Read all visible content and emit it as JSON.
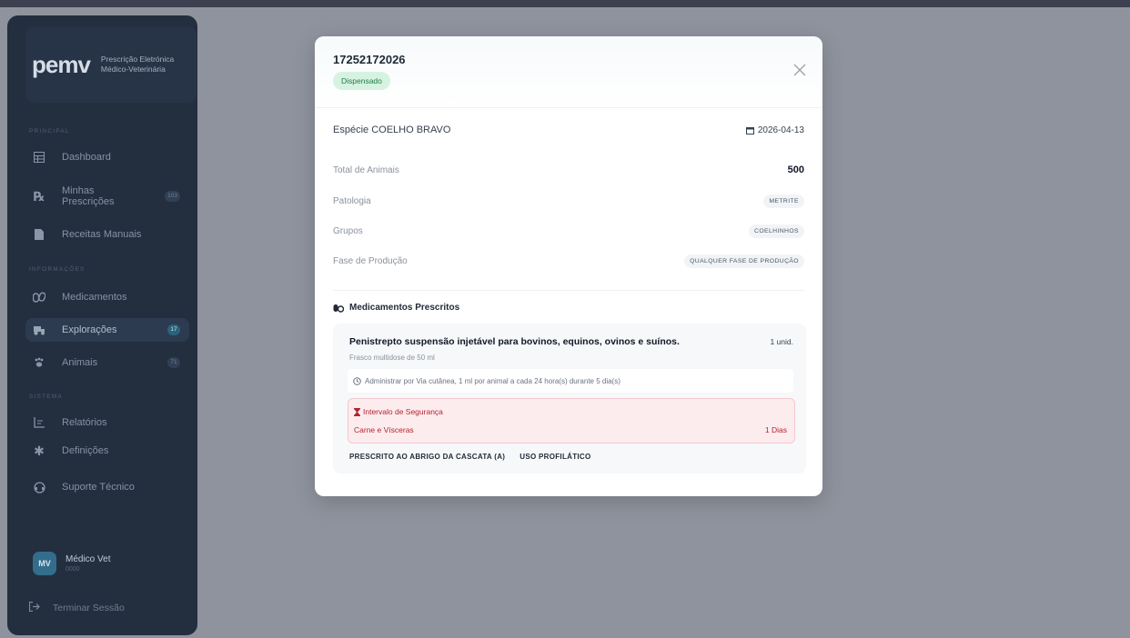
{
  "brand": {
    "logo": "pemv",
    "line1": "Prescrição Eletrónica",
    "line2": "Médico-Veterinária"
  },
  "sidebar": {
    "sections": [
      "Principal",
      "Informações",
      "Sistema"
    ],
    "items": [
      {
        "label": "Dashboard",
        "icon": "grid-icon"
      },
      {
        "label": "Minhas Prescrições",
        "icon": "rx-icon",
        "badge": "103"
      },
      {
        "label": "Receitas Manuais",
        "icon": "document-icon"
      },
      {
        "label": "Medicamentos",
        "icon": "pills-icon"
      },
      {
        "label": "Explorações",
        "icon": "tractor-icon",
        "badge": "17"
      },
      {
        "label": "Animais",
        "icon": "paw-icon",
        "badge": "71"
      },
      {
        "label": "Relatórios",
        "icon": "chart-icon"
      },
      {
        "label": "Definições",
        "icon": "gear-icon"
      },
      {
        "label": "Suporte Técnico",
        "icon": "headset-icon"
      }
    ],
    "user": {
      "initials": "MV",
      "name": "Médico Vet",
      "sub": "0000"
    },
    "logout": "Terminar Sessão"
  },
  "modal": {
    "id": "17252172026",
    "status": "Dispensado",
    "species_label": "Espécie",
    "species": "COELHO BRAVO",
    "date": "2026-04-13",
    "rows": [
      {
        "label": "Total de Animais",
        "value": "500"
      },
      {
        "label": "Patologia",
        "value": "METRITE"
      },
      {
        "label": "Grupos",
        "value": "COELHINHOS"
      },
      {
        "label": "Fase de Produção",
        "value": "QUALQUER FASE DE PRODUÇÃO"
      }
    ],
    "meds_title": "Medicamentos Prescritos",
    "medication": {
      "name": "Penistrepto suspensão injetável para bovinos, equinos, ovinos e suínos.",
      "qty": "1 unid.",
      "pack": "Frasco multidose de 50 ml",
      "admin": "Administrar por Via cutânea, 1 ml por animal a cada 24 hora(s) durante 5 dia(s)",
      "safety_title": "Intervalo de Segurança",
      "safety_item": "Carne e Vísceras",
      "safety_value": "1 Dias",
      "tags": [
        "PRESCRITO AO ABRIGO DA CASCATA (A)",
        "USO PROFILÁTICO"
      ]
    }
  }
}
